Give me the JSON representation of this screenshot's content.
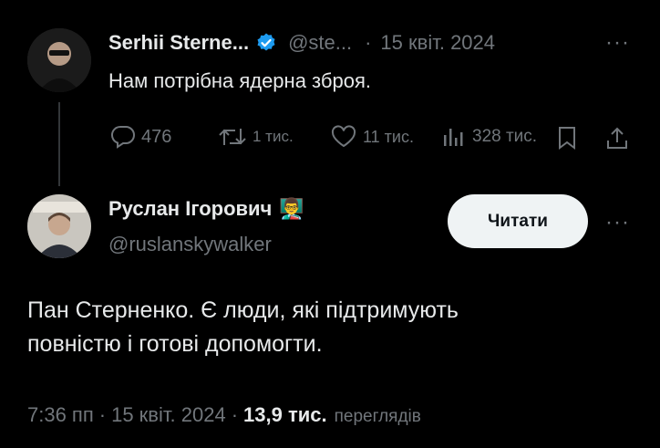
{
  "quoted": {
    "author_name": "Serhii Sterne...",
    "handle": "@ste...",
    "separator": "·",
    "date": "15 квіт. 2024",
    "text": "Нам потрібна ядерна зброя.",
    "replies": "476",
    "reposts": "1 тис.",
    "likes": "11 тис.",
    "views": "328 тис."
  },
  "reply": {
    "author_name": "Руслан Ігорович",
    "author_emoji": "👨‍🏫",
    "handle": "@ruslanskywalker",
    "follow_label": "Читати",
    "text_line1": "Пан Стерненко. Є люди, які підтримують",
    "text_line2": "повністю і готові допомогти.",
    "time": "7:36 пп",
    "date": "15 квіт. 2024",
    "views_count": "13,9 тис.",
    "views_label": "переглядів"
  },
  "icons": {
    "verified": "verified-badge-icon",
    "more": "more-dots-icon",
    "reply": "reply-bubble-icon",
    "repost": "repost-icon",
    "like": "heart-icon",
    "views": "bar-chart-icon",
    "bookmark": "bookmark-icon",
    "share": "share-icon"
  },
  "colors": {
    "background": "#000000",
    "text": "#e7e9ea",
    "muted": "#71767b",
    "verified": "#1d9bf0",
    "button_bg": "#eff3f4"
  }
}
